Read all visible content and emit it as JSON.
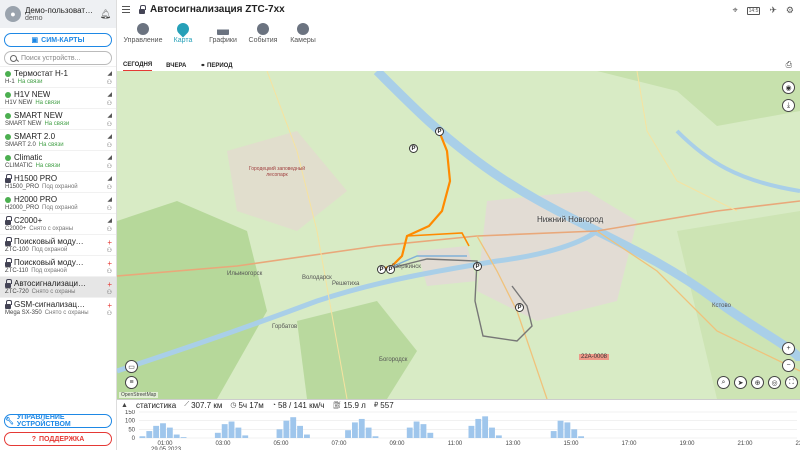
{
  "user": {
    "name": "Демо-пользовате...",
    "login": "demo"
  },
  "sidebar": {
    "sim_label": "СИМ-КАРТЫ",
    "search_placeholder": "Поиск устройств...",
    "devices": [
      {
        "name": "Термостат Н-1",
        "model": "H-1",
        "status": "На связи",
        "icon": "dot"
      },
      {
        "name": "H1V NEW",
        "model": "H1V NEW",
        "status": "На связи",
        "icon": "dot"
      },
      {
        "name": "SMART NEW",
        "model": "SMART NEW",
        "status": "На связи",
        "icon": "dot"
      },
      {
        "name": "SMART 2.0",
        "model": "SMART 2.0",
        "status": "На связи",
        "icon": "dot"
      },
      {
        "name": "Climatic",
        "model": "CLIMATIC",
        "status": "На связи",
        "icon": "dot"
      },
      {
        "name": "H1500 PRO",
        "model": "H1500_PRO",
        "status": "Под охраной",
        "icon": "lock"
      },
      {
        "name": "H2000 PRO",
        "model": "H2000_PRO",
        "status": "Под охраной",
        "icon": "dot"
      },
      {
        "name": "C2000+",
        "model": "C2000+",
        "status": "Снято с охраны",
        "icon": "lock"
      },
      {
        "name": "Поисковый модуль ...",
        "model": "ZTC-100",
        "status": "Под охраной",
        "icon": "lock"
      },
      {
        "name": "Поисковый модуль ...",
        "model": "ZTC-110",
        "status": "Под охраной",
        "icon": "lock"
      },
      {
        "name": "Автосигнализация Z...",
        "model": "ZTC-720",
        "status": "Снято с охраны",
        "icon": "lock"
      },
      {
        "name": "GSM-сигнализация ...",
        "model": "Mega SX-350",
        "status": "Снято с охраны",
        "icon": "lock"
      }
    ],
    "manage_label": "УПРАВЛЕНИЕ УСТРОЙСТВОМ",
    "support_label": "ПОДДЕРЖКА"
  },
  "header": {
    "title": "Автосигнализация ZTC-7xx",
    "calendar_label": "14:5",
    "tabs": [
      {
        "label": "Управление"
      },
      {
        "label": "Карта"
      },
      {
        "label": "Графики"
      },
      {
        "label": "События"
      },
      {
        "label": "Камеры"
      }
    ]
  },
  "period": {
    "today": "СЕГОДНЯ",
    "yesterday": "ВЧЕРА",
    "period": "ПЕРИОД"
  },
  "map": {
    "city": "Нижний Новгород",
    "reserve": "Городецкий заповедный лесопарк",
    "labels": [
      "Кстово",
      "Богородск",
      "Дзержинск",
      "Володарск",
      "Горбатов",
      "Ильиногорск",
      "Решетиха",
      "22А-0008"
    ],
    "attribution": "OpenStreetMap"
  },
  "stats": {
    "title": "статистика",
    "distance": "307.7 км",
    "duration": "5ч 17м",
    "speed": "58 / 141 км/ч",
    "fuel": "15.9 л",
    "cost": "557"
  },
  "chart_data": {
    "type": "bar",
    "ylabels": [
      "150",
      "100",
      "50",
      "0"
    ],
    "ylim": [
      0,
      150
    ],
    "x_ticks": [
      "01:00",
      "03:00",
      "05:00",
      "07:00",
      "09:00",
      "11:00",
      "13:00",
      "15:00",
      "17:00",
      "19:00",
      "21:00",
      "23:00"
    ],
    "date_label": "29.05.2023",
    "series": [
      {
        "values": [
          10,
          40,
          70,
          85,
          60,
          20,
          5,
          0,
          0,
          0,
          0,
          30,
          80,
          95,
          60,
          15,
          0,
          0,
          0,
          0,
          50,
          100,
          120,
          70,
          20,
          0,
          0,
          0,
          0,
          0,
          45,
          90,
          110,
          60,
          10,
          0,
          0,
          0,
          0,
          60,
          95,
          80,
          30,
          0,
          0,
          0,
          0,
          0,
          70,
          110,
          125,
          60,
          15,
          0,
          0,
          0,
          0,
          0,
          0,
          0,
          40,
          100,
          90,
          50,
          10,
          0,
          0,
          0,
          0,
          0,
          0,
          0,
          0,
          0,
          0,
          0,
          0,
          0,
          0,
          0,
          0,
          0,
          0,
          0,
          0,
          0,
          0,
          0,
          0,
          0,
          0,
          0,
          0,
          0,
          0,
          0
        ]
      }
    ]
  }
}
